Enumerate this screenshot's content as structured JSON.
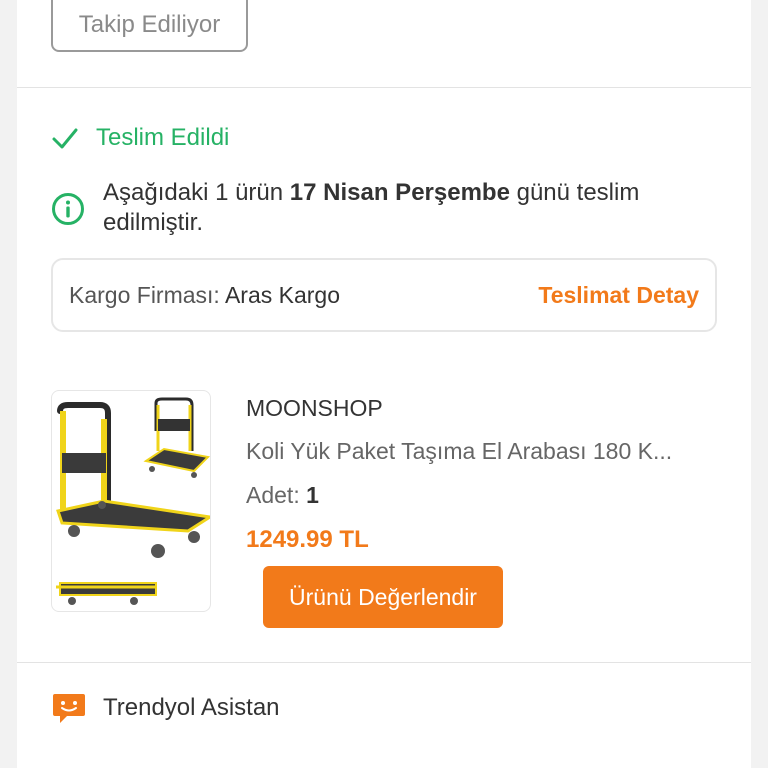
{
  "header": {
    "follow_label": "Takip Ediliyor"
  },
  "delivery": {
    "status": "Teslim Edildi",
    "info_prefix": "Aşağıdaki 1 ürün ",
    "info_date": "17 Nisan Perşembe",
    "info_suffix": " günü teslim edilmiştir.",
    "cargo_label": "Kargo Firması: ",
    "cargo_company": "Aras Kargo",
    "detail_link": "Teslimat Detay"
  },
  "product": {
    "seller": "MOONSHOP",
    "name": "Koli Yük Paket Taşıma El Arabası 180 K...",
    "qty_label": "Adet: ",
    "qty_value": "1",
    "price": "1249.99 TL",
    "rate_label": "Ürünü Değerlendir"
  },
  "assistant": {
    "label": "Trendyol Asistan"
  },
  "colors": {
    "accent": "#f27a1a",
    "success": "#26b265",
    "text": "#333333"
  },
  "icons": {
    "status": "checkmark-icon",
    "info": "info-icon",
    "assistant": "chat-bubble-icon"
  }
}
